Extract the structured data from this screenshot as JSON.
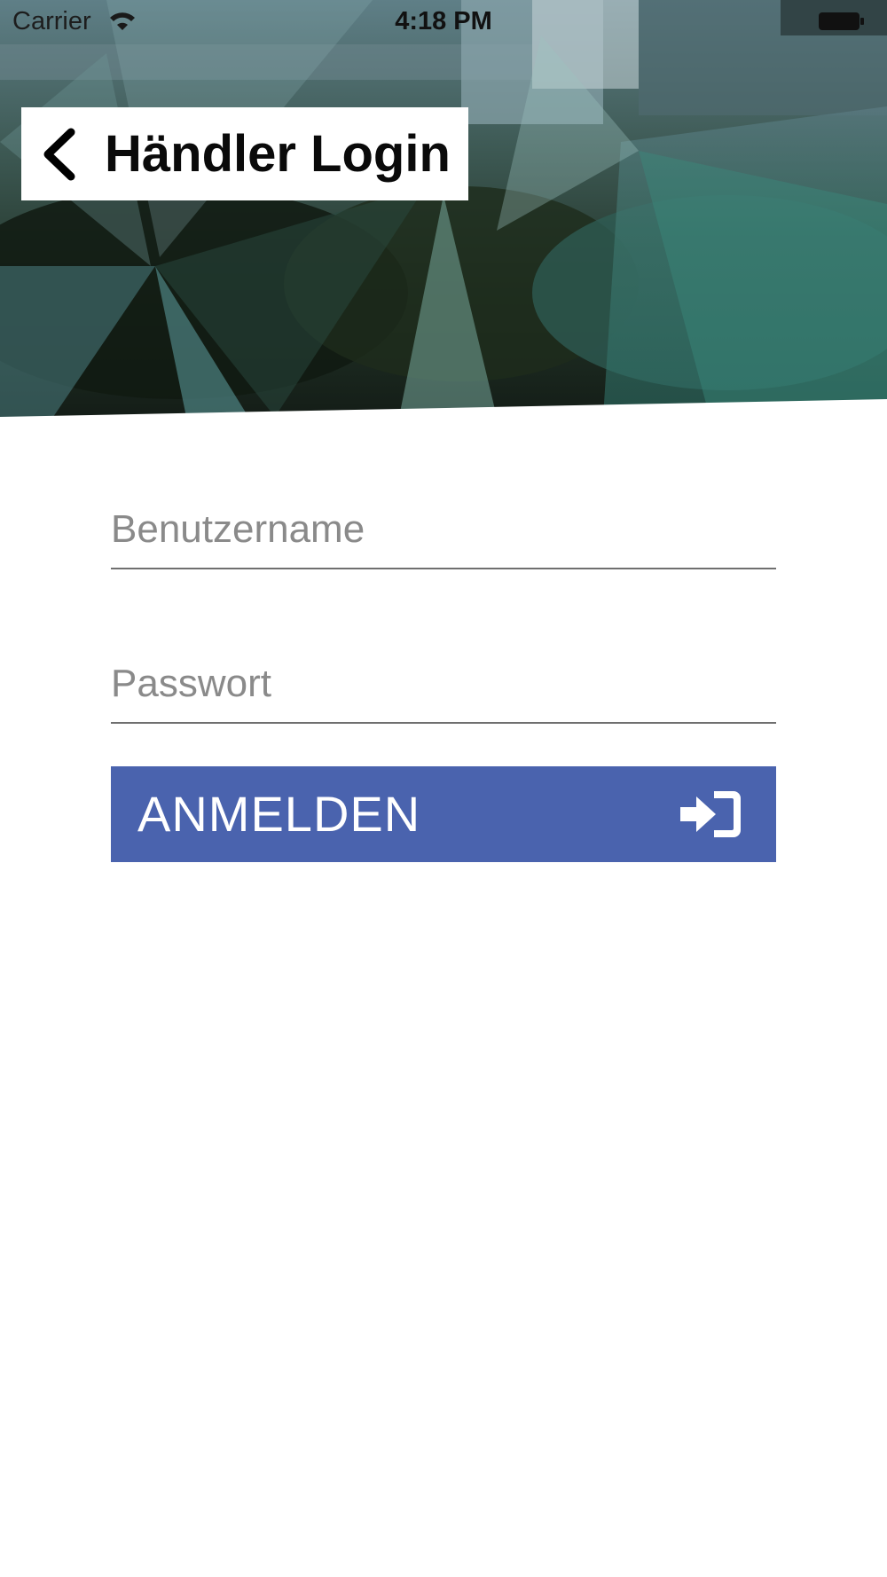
{
  "status_bar": {
    "carrier": "Carrier",
    "time": "4:18 PM",
    "wifi_icon": "wifi-icon",
    "battery_icon": "battery-icon"
  },
  "header": {
    "title": "Händler Login",
    "back_icon": "chevron-left-icon"
  },
  "form": {
    "username": {
      "placeholder": "Benutzername",
      "value": ""
    },
    "password": {
      "placeholder": "Passwort",
      "value": ""
    },
    "submit": {
      "label": "ANMELDEN",
      "icon": "sign-in-icon"
    }
  },
  "colors": {
    "button_background": "#4a63ae",
    "button_text": "#ffffff",
    "field_underline": "#6f6f6f",
    "placeholder_text": "#8a8a8a"
  }
}
